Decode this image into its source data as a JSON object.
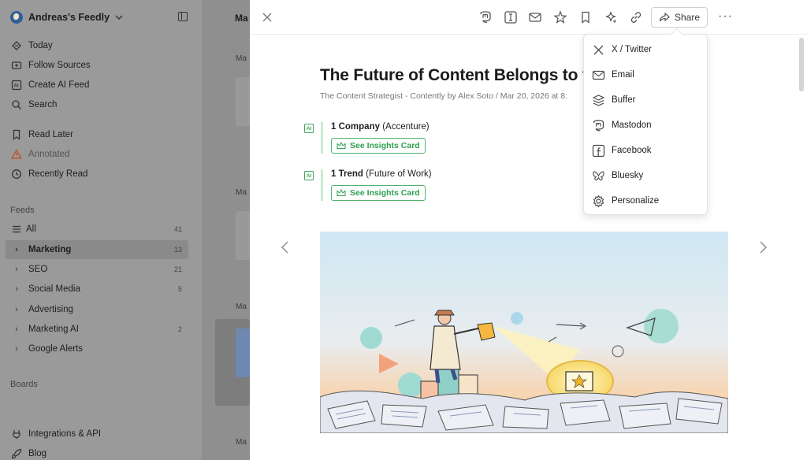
{
  "sidebar": {
    "account_name": "Andreas's Feedly",
    "nav": [
      {
        "label": "Today",
        "icon": "today-icon"
      },
      {
        "label": "Follow Sources",
        "icon": "follow-sources-icon"
      },
      {
        "label": "Create AI Feed",
        "icon": "ai-feed-icon"
      },
      {
        "label": "Search",
        "icon": "search-icon"
      }
    ],
    "nav2": [
      {
        "label": "Read Later",
        "icon": "bookmark-icon"
      },
      {
        "label": "Annotated",
        "icon": "annotated-icon"
      },
      {
        "label": "Recently Read",
        "icon": "history-icon"
      }
    ],
    "feeds_label": "Feeds",
    "feeds": [
      {
        "label": "All",
        "count": "41"
      },
      {
        "label": "Marketing",
        "count": "13"
      },
      {
        "label": "SEO",
        "count": "21"
      },
      {
        "label": "Social Media",
        "count": "5"
      },
      {
        "label": "Advertising",
        "count": ""
      },
      {
        "label": "Marketing AI",
        "count": "2"
      },
      {
        "label": "Google Alerts",
        "count": ""
      }
    ],
    "boards_label": "Boards",
    "bottom": [
      {
        "label": "Integrations & API",
        "icon": "integrations-icon"
      },
      {
        "label": "Blog",
        "icon": "rocket-icon"
      }
    ]
  },
  "middle": {
    "title": "Ma",
    "subs": [
      "Ma",
      "Ma",
      "Ma",
      "Ma"
    ]
  },
  "reader": {
    "toolbar_icons": [
      "mastodon-icon",
      "text-cursor-icon",
      "email-icon",
      "star-icon",
      "bookmark-icon",
      "sparkle-icon",
      "link-icon"
    ],
    "share_label": "Share",
    "more_label": "···",
    "title": "The Future of Content Belongs to th",
    "meta": "The Content Strategist - Contently by Alex Soto / Mar 20, 2026 at 8:",
    "insights": [
      {
        "badge": "AI",
        "bold": "1 Company",
        "rest": "(Accenture)",
        "button": "See Insights Card"
      },
      {
        "badge": "AI",
        "bold": "1 Trend",
        "rest": "(Future of Work)",
        "button": "See Insights Card"
      }
    ]
  },
  "share_menu": [
    {
      "label": "X / Twitter",
      "icon": "x-twitter-icon"
    },
    {
      "label": "Email",
      "icon": "email-icon"
    },
    {
      "label": "Buffer",
      "icon": "buffer-icon"
    },
    {
      "label": "Mastodon",
      "icon": "mastodon-icon"
    },
    {
      "label": "Facebook",
      "icon": "facebook-icon"
    },
    {
      "label": "Bluesky",
      "icon": "bluesky-icon"
    },
    {
      "label": "Personalize",
      "icon": "gear-icon"
    }
  ],
  "colors": {
    "accent_green": "#2f9e4f",
    "overlay_gray": "#9a9a9a",
    "warning_orange": "#c0502a"
  }
}
